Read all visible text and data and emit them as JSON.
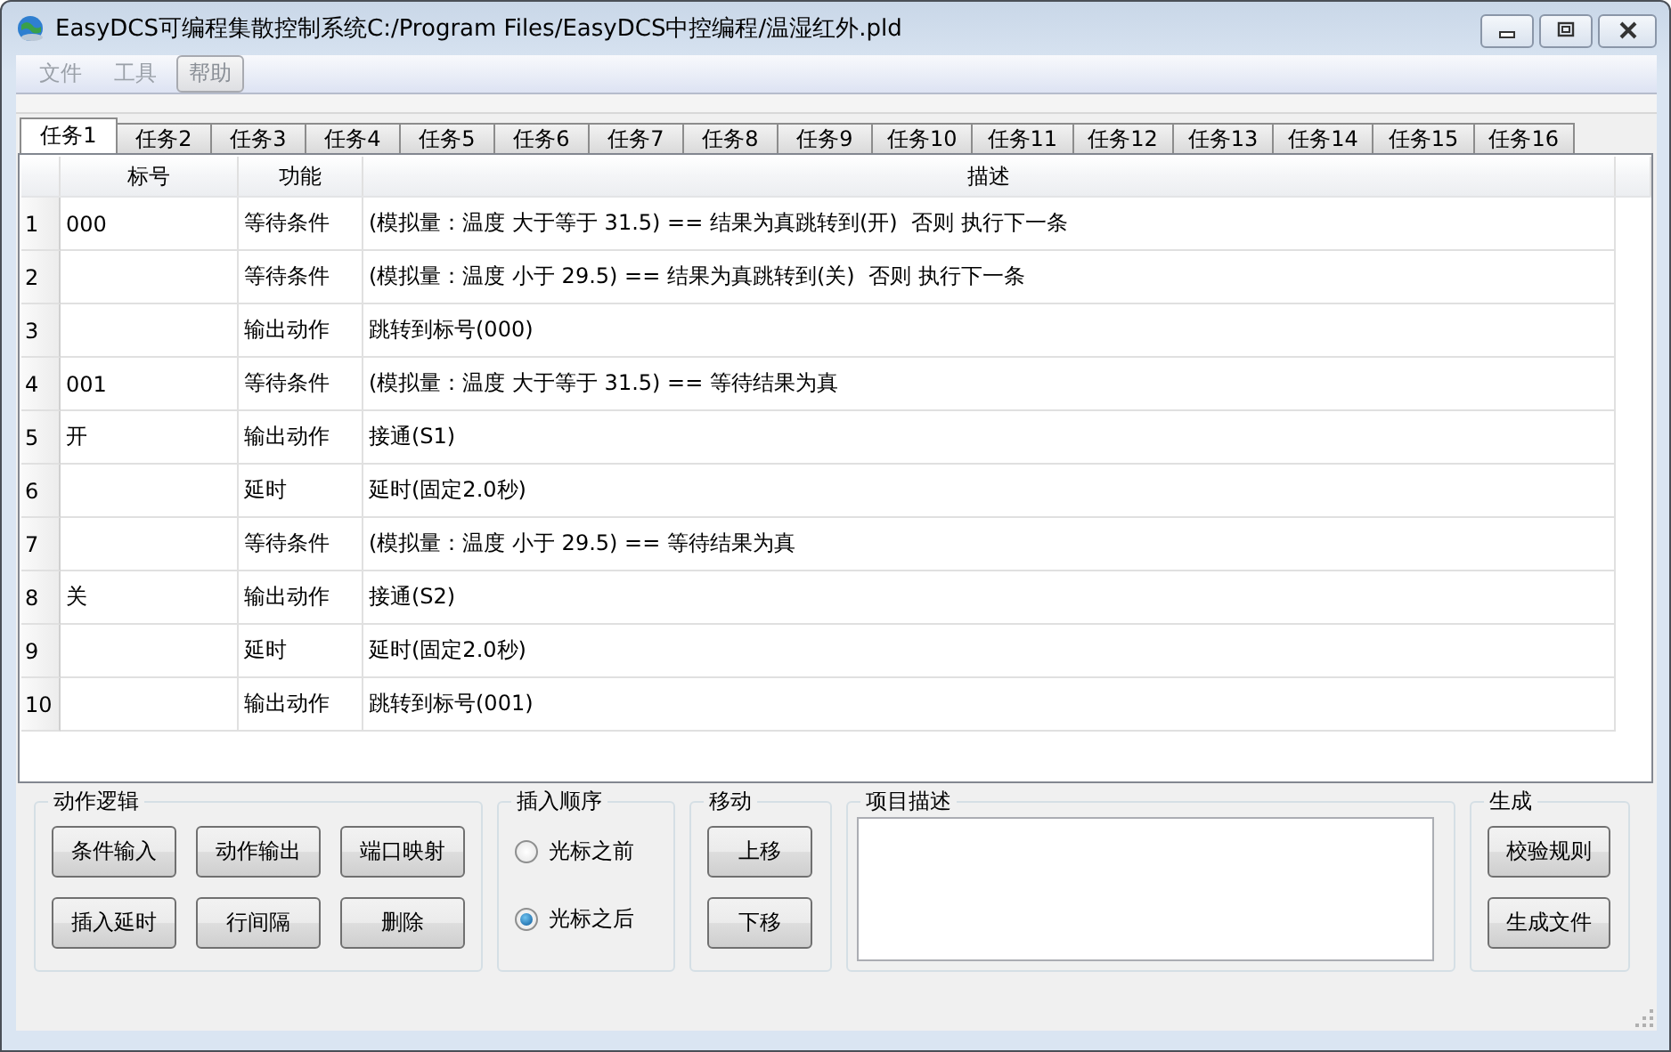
{
  "window": {
    "title": "EasyDCS可编程集散控制系统C:/Program Files/EasyDCS中控编程/温湿红外.pld"
  },
  "menu": [
    {
      "label": "文件",
      "highlighted": false
    },
    {
      "label": "工具",
      "highlighted": false
    },
    {
      "label": "帮助",
      "highlighted": true
    }
  ],
  "tabs": [
    {
      "label": "任务1",
      "selected": true
    },
    {
      "label": "任务2",
      "selected": false
    },
    {
      "label": "任务3",
      "selected": false
    },
    {
      "label": "任务4",
      "selected": false
    },
    {
      "label": "任务5",
      "selected": false
    },
    {
      "label": "任务6",
      "selected": false
    },
    {
      "label": "任务7",
      "selected": false
    },
    {
      "label": "任务8",
      "selected": false
    },
    {
      "label": "任务9",
      "selected": false
    },
    {
      "label": "任务10",
      "selected": false
    },
    {
      "label": "任务11",
      "selected": false
    },
    {
      "label": "任务12",
      "selected": false
    },
    {
      "label": "任务13",
      "selected": false
    },
    {
      "label": "任务14",
      "selected": false
    },
    {
      "label": "任务15",
      "selected": false
    },
    {
      "label": "任务16",
      "selected": false
    }
  ],
  "table": {
    "columns": [
      "标号",
      "功能",
      "描述"
    ],
    "rows": [
      {
        "number": "1",
        "label": "000",
        "function": "等待条件",
        "description": "(模拟量：温度 大于等于 31.5) == 结果为真跳转到(开)  否则 执行下一条"
      },
      {
        "number": "2",
        "function": "等待条件",
        "description": "(模拟量：温度 小于 29.5) == 结果为真跳转到(关)  否则 执行下一条"
      },
      {
        "number": "3",
        "function": "输出动作",
        "description": "跳转到标号(000)"
      },
      {
        "number": "4",
        "label": "001",
        "function": "等待条件",
        "description": "(模拟量：温度 大于等于 31.5) == 等待结果为真"
      },
      {
        "number": "5",
        "label": "开",
        "function": "输出动作",
        "description": "接通(S1)"
      },
      {
        "number": "6",
        "function": "延时",
        "description": "延时(固定2.0秒)"
      },
      {
        "number": "7",
        "function": "等待条件",
        "description": "(模拟量：温度 小于 29.5) == 等待结果为真"
      },
      {
        "number": "8",
        "label": "关",
        "function": "输出动作",
        "description": "接通(S2)"
      },
      {
        "number": "9",
        "function": "延时",
        "description": "延时(固定2.0秒)"
      },
      {
        "number": "10",
        "function": "输出动作",
        "description": "跳转到标号(001)"
      }
    ]
  },
  "action_logic": {
    "title": "动作逻辑",
    "buttons": [
      "条件输入",
      "动作输出",
      "端口映射",
      "插入延时",
      "行间隔",
      "删除"
    ]
  },
  "insert_order": {
    "title": "插入顺序",
    "options": [
      {
        "label": "光标之前",
        "selected": false
      },
      {
        "label": "光标之后",
        "selected": true
      }
    ]
  },
  "move": {
    "title": "移动",
    "buttons": [
      "上移",
      "下移"
    ]
  },
  "project_description": {
    "title": "项目描述"
  },
  "generate": {
    "title": "生成",
    "buttons": [
      "校验规则",
      "生成文件"
    ]
  }
}
